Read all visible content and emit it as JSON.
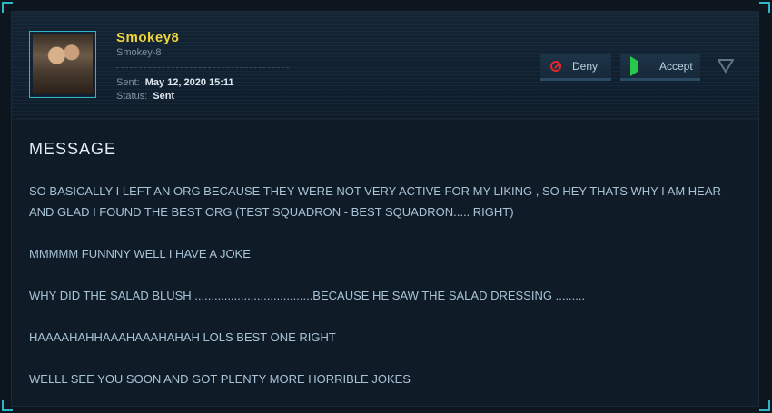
{
  "user": {
    "display_name": "Smokey8",
    "handle": "Smokey-8"
  },
  "meta": {
    "sent_label": "Sent:",
    "sent_value": "May 12, 2020 15:11",
    "status_label": "Status:",
    "status_value": "Sent"
  },
  "actions": {
    "deny_label": "Deny",
    "accept_label": "Accept"
  },
  "icons": {
    "deny": "deny-icon",
    "accept": "accept-icon",
    "toggle": "chevron-down-icon"
  },
  "message": {
    "title": "MESSAGE",
    "paragraphs": [
      "SO BASICALLY I LEFT AN ORG BECAUSE THEY WERE NOT VERY ACTIVE FOR MY LIKING , SO HEY THATS WHY I AM HEAR AND GLAD I FOUND THE BEST ORG (TEST SQUADRON - BEST SQUADRON..... RIGHT)",
      "MMMMM FUNNNY WELL I HAVE A JOKE",
      "WHY DID THE SALAD BLUSH ....................................BECAUSE HE SAW THE SALAD DRESSING .........",
      "HAAAAHAHHAAAHAAAHAHAH LOLS BEST ONE RIGHT",
      "WELLL SEE YOU SOON AND GOT PLENTY MORE HORRIBLE JOKES"
    ]
  },
  "colors": {
    "accent": "#2fb4c8",
    "username": "#f0d43c",
    "deny": "#e0282a",
    "accept": "#28c84a"
  }
}
